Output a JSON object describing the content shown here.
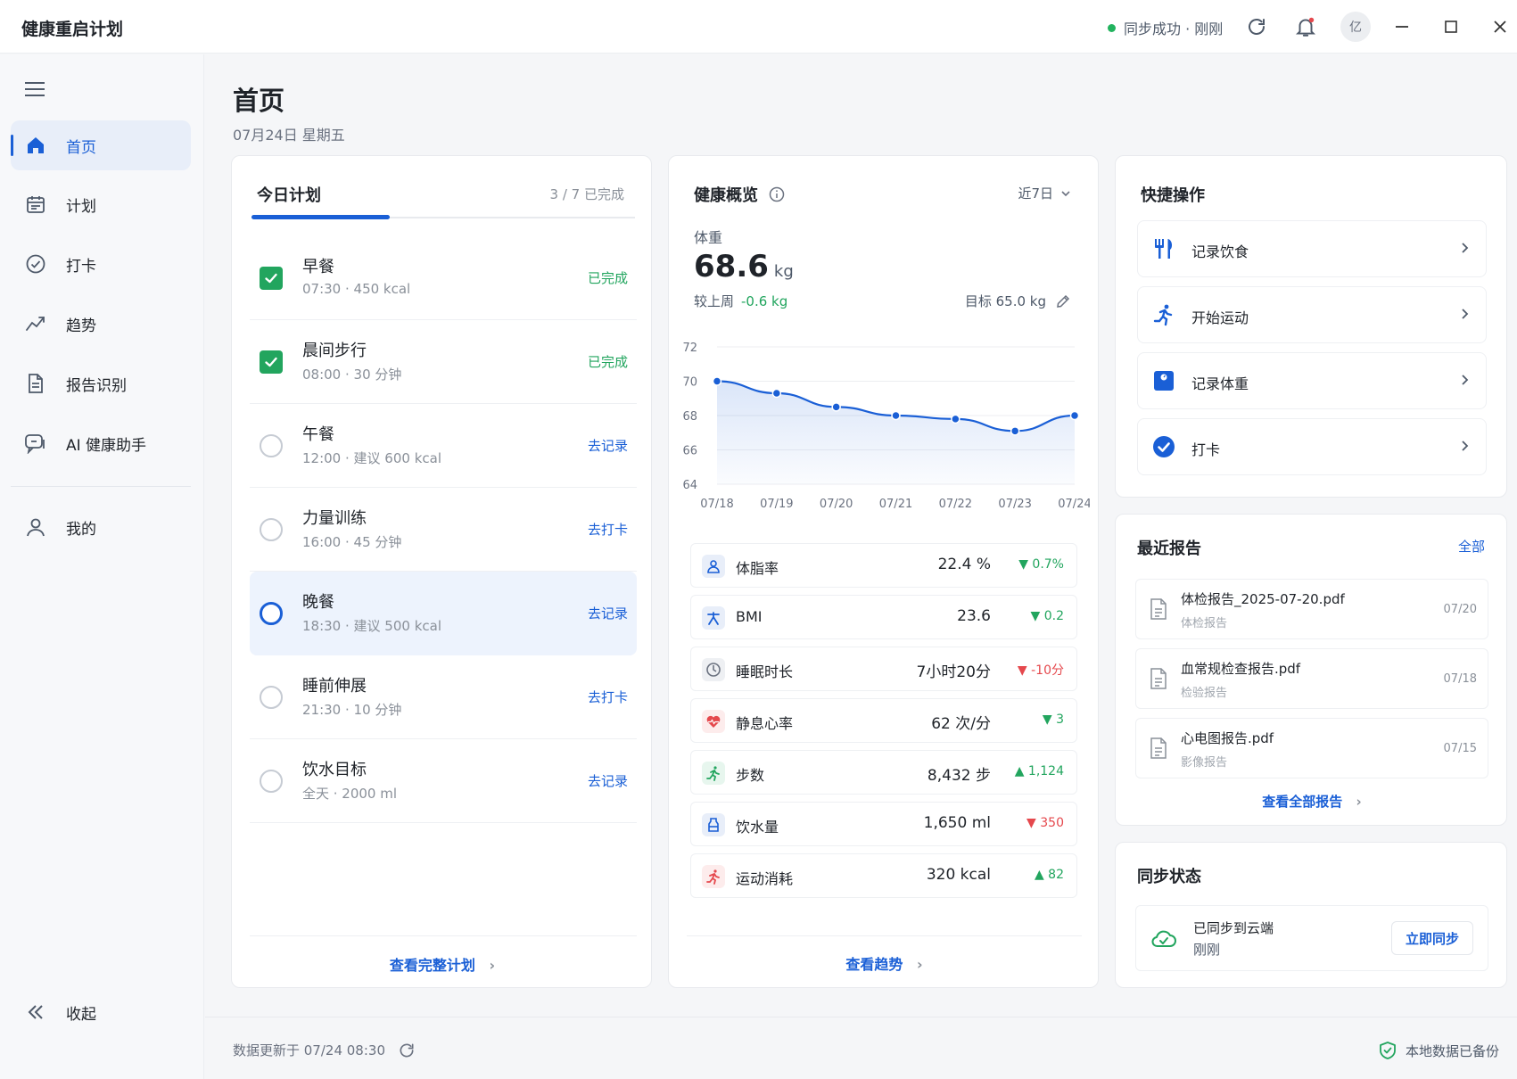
{
  "app": {
    "title": "健康重启计划"
  },
  "titlebar": {
    "sync_text": "同步成功 · 刚刚",
    "avatar_text": "亿",
    "icons": [
      "refresh-icon",
      "bell-icon",
      "minimize-icon",
      "maximize-icon",
      "close-icon"
    ]
  },
  "sidebar": {
    "items": [
      {
        "label": "首页",
        "icon": "home-icon",
        "active": true
      },
      {
        "label": "计划",
        "icon": "calendar-icon"
      },
      {
        "label": "打卡",
        "icon": "check-circle-icon"
      },
      {
        "label": "趋势",
        "icon": "trend-icon"
      },
      {
        "label": "报告识别",
        "icon": "document-icon"
      },
      {
        "label": "AI 健康助手",
        "icon": "chat-icon"
      },
      {
        "label": "我的",
        "icon": "user-icon"
      }
    ],
    "collapse_label": "收起"
  },
  "page": {
    "title": "首页",
    "date": "07月24日  星期五"
  },
  "plan": {
    "title": "今日计划",
    "progress_text": "3 / 7 已完成",
    "progress_fraction": 0.36,
    "items": [
      {
        "name": "早餐",
        "meta": "07:30 · 450 kcal",
        "action": "已完成",
        "status": "done"
      },
      {
        "name": "晨间步行",
        "meta": "08:00 · 30 分钟",
        "action": "已完成",
        "status": "done"
      },
      {
        "name": "午餐",
        "meta": "12:00 · 建议 600 kcal",
        "action": "去记录",
        "status": "todo"
      },
      {
        "name": "力量训练",
        "meta": "16:00 · 45 分钟",
        "action": "去打卡",
        "status": "todo"
      },
      {
        "name": "晚餐",
        "meta": "18:30 · 建议 500 kcal",
        "action": "去记录",
        "status": "current"
      },
      {
        "name": "睡前伸展",
        "meta": "21:30 · 10 分钟",
        "action": "去打卡",
        "status": "todo"
      },
      {
        "name": "饮水目标",
        "meta": "全天 · 2000 ml",
        "action": "去记录",
        "status": "todo"
      }
    ],
    "footer_link": "查看完整计划"
  },
  "health": {
    "title": "健康概览",
    "range": "近7日",
    "weight_label": "体重",
    "weight_value": "68.6",
    "weight_unit": "kg",
    "compare_label": "较上周",
    "compare_delta": "-0.6 kg",
    "target_text": "目标  65.0 kg",
    "metrics": [
      {
        "name": "体脂率",
        "value": "22.4 %",
        "change": "▼ 0.7%",
        "trend": "good",
        "icon": "body-fat-icon",
        "color": "#1a5fd6"
      },
      {
        "name": "BMI",
        "value": "23.6",
        "change": "▼ 0.2",
        "trend": "good",
        "icon": "bmi-icon",
        "color": "#1a5fd6"
      },
      {
        "name": "睡眠时长",
        "value": "7小时20分",
        "change": "▼ -10分",
        "trend": "bad",
        "icon": "sleep-icon",
        "color": "#6b7280"
      },
      {
        "name": "静息心率",
        "value": "62 次/分",
        "change": "▼ 3",
        "trend": "good",
        "icon": "heart-icon",
        "color": "#e5484d"
      },
      {
        "name": "步数",
        "value": "8,432 步",
        "change": "▲ 1,124",
        "trend": "good",
        "icon": "steps-icon",
        "color": "#22a55e"
      },
      {
        "name": "饮水量",
        "value": "1,650 ml",
        "change": "▼ 350",
        "trend": "bad",
        "icon": "water-icon",
        "color": "#1a5fd6"
      },
      {
        "name": "运动消耗",
        "value": "320 kcal",
        "change": "▲ 82",
        "trend": "good",
        "icon": "exercise-icon",
        "color": "#e5484d"
      }
    ],
    "footer_link": "查看趋势"
  },
  "chart_data": {
    "type": "line",
    "x": [
      "07/18",
      "07/19",
      "07/20",
      "07/21",
      "07/22",
      "07/23",
      "07/24"
    ],
    "series": [
      {
        "values": [
          70.0,
          69.3,
          68.5,
          68.0,
          67.8,
          67.1,
          68.0
        ]
      }
    ],
    "ylim": [
      64,
      72
    ],
    "yticks": [
      72,
      70,
      68,
      66,
      64
    ],
    "grid": true,
    "line_color": "#1a5fd6"
  },
  "quick": {
    "title": "快捷操作",
    "items": [
      {
        "label": "记录饮食",
        "icon": "utensils-icon"
      },
      {
        "label": "开始运动",
        "icon": "running-icon"
      },
      {
        "label": "记录体重",
        "icon": "scale-icon"
      },
      {
        "label": "打卡",
        "icon": "checkin-icon"
      }
    ]
  },
  "reports": {
    "title": "最近报告",
    "all_link": "全部",
    "items": [
      {
        "name": "体检报告_2025-07-20.pdf",
        "type": "体检报告",
        "date": "07/20"
      },
      {
        "name": "血常规检查报告.pdf",
        "type": "检验报告",
        "date": "07/18"
      },
      {
        "name": "心电图报告.pdf",
        "type": "影像报告",
        "date": "07/15"
      }
    ],
    "footer_link": "查看全部报告"
  },
  "sync": {
    "title": "同步状态",
    "status": "已同步到云端",
    "time": "刚刚",
    "button": "立即同步"
  },
  "statusbar": {
    "updated": "数据更新于 07/24 08:30",
    "backup": "本地数据已备份"
  }
}
